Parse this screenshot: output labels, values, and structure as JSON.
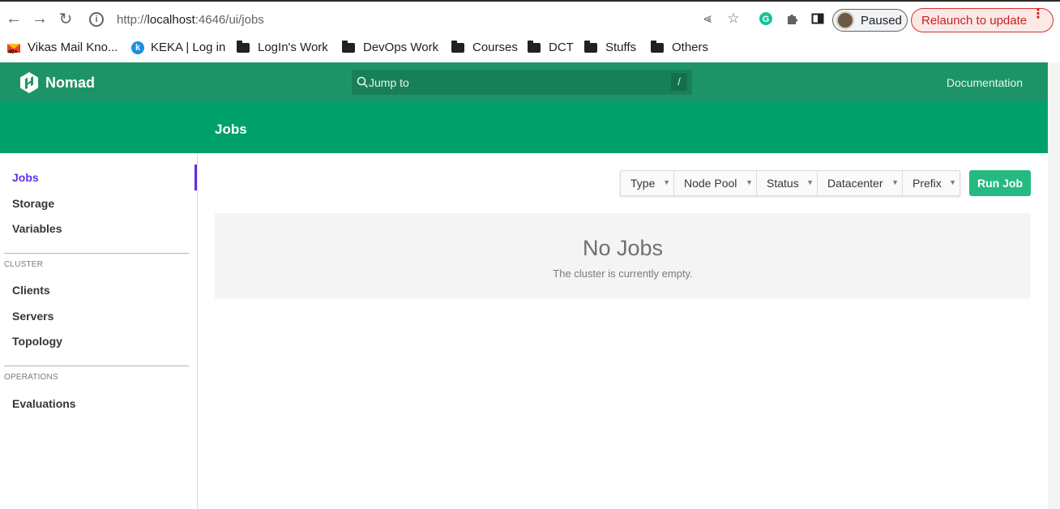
{
  "browser": {
    "url_prefix": "http://",
    "url_host": "localhost",
    "url_rest": ":4646/ui/jobs",
    "profile_label": "Paused",
    "relaunch_label": "Relaunch to update"
  },
  "bookmarks": [
    {
      "label": "Vikas Mail Kno...",
      "icon": "gmail-icon"
    },
    {
      "label": "KEKA | Log in",
      "icon": "keka-icon"
    },
    {
      "label": "LogIn's Work",
      "icon": "folder-icon"
    },
    {
      "label": "DevOps Work",
      "icon": "folder-icon"
    },
    {
      "label": "Courses",
      "icon": "folder-icon"
    },
    {
      "label": "DCT",
      "icon": "folder-icon"
    },
    {
      "label": "Stuffs",
      "icon": "folder-icon"
    },
    {
      "label": "Others",
      "icon": "folder-icon"
    }
  ],
  "app": {
    "brand": "Nomad",
    "search_placeholder": "Jump to",
    "search_shortcut": "/",
    "documentation": "Documentation",
    "page_title": "Jobs"
  },
  "sidebar": {
    "items_top": [
      "Jobs",
      "Storage",
      "Variables"
    ],
    "cluster_heading": "CLUSTER",
    "cluster_items": [
      "Clients",
      "Servers",
      "Topology"
    ],
    "operations_heading": "OPERATIONS",
    "operations_items": [
      "Evaluations"
    ]
  },
  "filters": [
    "Type",
    "Node Pool",
    "Status",
    "Datacenter",
    "Prefix"
  ],
  "run_job": "Run Job",
  "empty": {
    "title": "No Jobs",
    "message": "The cluster is currently empty."
  }
}
